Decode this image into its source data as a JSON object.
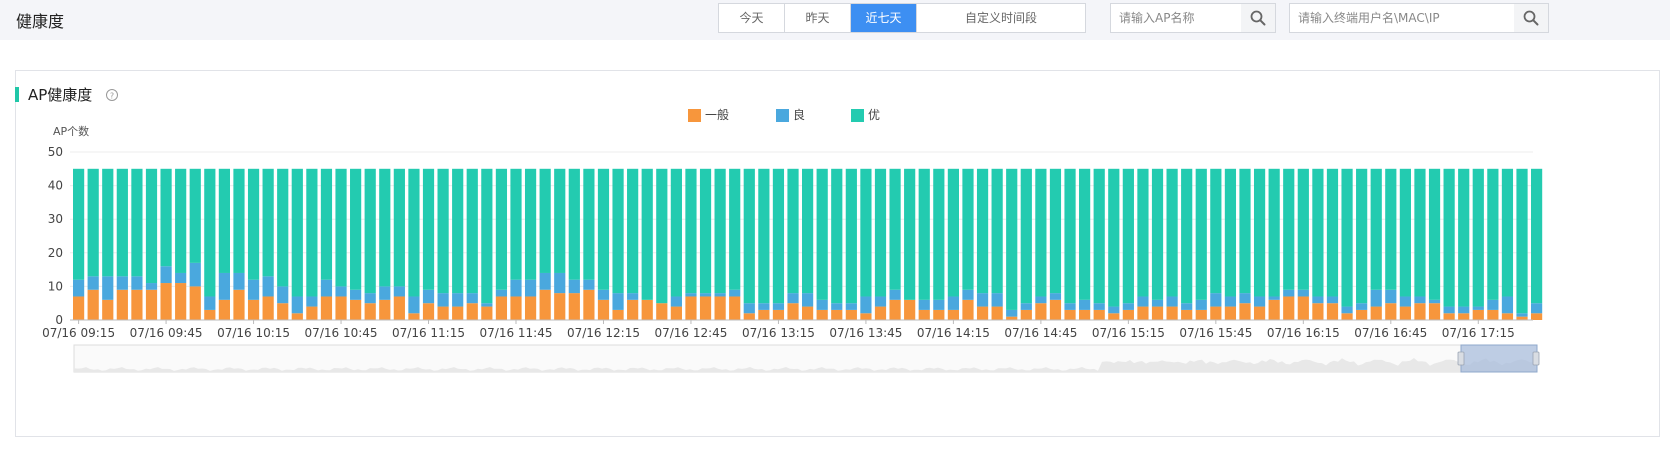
{
  "header": {
    "title": "健康度",
    "tabs": [
      {
        "label": "今天",
        "active": false
      },
      {
        "label": "昨天",
        "active": false
      },
      {
        "label": "近七天",
        "active": true
      },
      {
        "label": "自定义时间段",
        "active": false
      }
    ],
    "ap_search": {
      "placeholder": "请输入AP名称",
      "icon": "search-icon"
    },
    "user_search": {
      "placeholder": "请输入终端用户名\\MAC\\IP",
      "icon": "search-icon"
    }
  },
  "panel": {
    "title": "AP健康度",
    "help_icon": "question-icon",
    "accent_color": "#20c7a8"
  },
  "chart_data": {
    "type": "bar",
    "stacked": true,
    "ylabel": "AP个数",
    "ylim": [
      0,
      50
    ],
    "yticks": [
      0,
      10,
      20,
      30,
      40,
      50
    ],
    "total_per_bar": 45,
    "xtick_labels": [
      "07/16 09:15",
      "07/16 09:45",
      "07/16 10:15",
      "07/16 10:45",
      "07/16 11:15",
      "07/16 11:45",
      "07/16 12:15",
      "07/16 12:45",
      "07/16 13:15",
      "07/16 13:45",
      "07/16 14:15",
      "07/16 14:45",
      "07/16 15:15",
      "07/16 15:45",
      "07/16 16:15",
      "07/16 16:45",
      "07/16 17:15"
    ],
    "legend_position": "top-center",
    "series": [
      {
        "name": "一般",
        "color": "#f7963c",
        "values": [
          7,
          9,
          6,
          9,
          9,
          9,
          11,
          11,
          10,
          3,
          6,
          9,
          6,
          7,
          5,
          2,
          4,
          7,
          7,
          6,
          5,
          6,
          7,
          2,
          5,
          4,
          4,
          5,
          4,
          7,
          7,
          7,
          9,
          8,
          8,
          9,
          6,
          3,
          6,
          6,
          5,
          4,
          7,
          7,
          7,
          7,
          2,
          3,
          3,
          5,
          4,
          3,
          3,
          3,
          2,
          4,
          6,
          6,
          3,
          3,
          3,
          6,
          4,
          4,
          1,
          3,
          5,
          6,
          3,
          3,
          3,
          2,
          3,
          4,
          4,
          4,
          3,
          3,
          4,
          4,
          5,
          4,
          6,
          7,
          7,
          5,
          5,
          2,
          3,
          4,
          5,
          4,
          5,
          5,
          2,
          2,
          3,
          3,
          2,
          1,
          2
        ]
      },
      {
        "name": "良",
        "color": "#4aa8de",
        "values": [
          5,
          4,
          7,
          4,
          4,
          2,
          5,
          3,
          7,
          4,
          8,
          5,
          6,
          6,
          5,
          5,
          3,
          5,
          3,
          3,
          3,
          4,
          3,
          5,
          4,
          4,
          4,
          3,
          1,
          2,
          5,
          5,
          5,
          6,
          4,
          3,
          3,
          5,
          2,
          0,
          0,
          3,
          1,
          1,
          1,
          2,
          3,
          2,
          2,
          3,
          4,
          3,
          2,
          2,
          5,
          3,
          3,
          0,
          3,
          3,
          4,
          3,
          4,
          4,
          2,
          2,
          2,
          2,
          2,
          3,
          2,
          2,
          2,
          3,
          2,
          3,
          2,
          3,
          4,
          3,
          3,
          3,
          1,
          2,
          2,
          2,
          2,
          2,
          2,
          5,
          4,
          3,
          2,
          1,
          2,
          2,
          1,
          3,
          5,
          1,
          3
        ]
      },
      {
        "name": "优",
        "color": "#23cbb0",
        "values": [
          33,
          32,
          32,
          32,
          32,
          34,
          29,
          31,
          28,
          38,
          31,
          31,
          33,
          32,
          35,
          38,
          38,
          33,
          35,
          36,
          37,
          35,
          35,
          38,
          36,
          37,
          37,
          37,
          40,
          36,
          33,
          33,
          31,
          31,
          33,
          33,
          36,
          37,
          37,
          39,
          40,
          38,
          37,
          37,
          37,
          36,
          40,
          40,
          40,
          37,
          37,
          39,
          40,
          40,
          38,
          38,
          36,
          39,
          39,
          39,
          38,
          36,
          37,
          37,
          42,
          40,
          38,
          37,
          40,
          39,
          40,
          41,
          40,
          38,
          39,
          38,
          40,
          39,
          37,
          38,
          37,
          38,
          38,
          36,
          36,
          38,
          38,
          41,
          40,
          36,
          36,
          38,
          38,
          39,
          41,
          41,
          41,
          39,
          38,
          43,
          40
        ]
      }
    ]
  }
}
